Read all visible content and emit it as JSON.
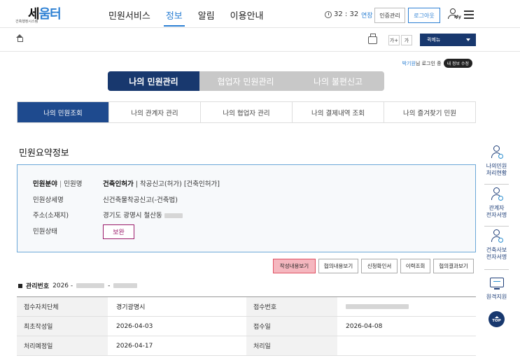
{
  "header": {
    "logo_main_prefix": "세",
    "logo_main_suffix": "움터",
    "logo_sub": "건축행정시스템",
    "nav": [
      "민원서비스",
      "정보",
      "알림",
      "이용안내"
    ],
    "active_nav_index": 1,
    "timer": "32 : 32",
    "extend_label": "연장",
    "cert_label": "인증관리",
    "logout_label": "로그아웃",
    "my_label": "My"
  },
  "subbar": {
    "font_up": "가+",
    "font_down": "가",
    "quick_menu": "퀵메뉴"
  },
  "login": {
    "user": "박기원",
    "suffix": "님 로그인 중",
    "edit": "내 정보 수정"
  },
  "big_tabs": [
    "나의 민원관리",
    "협업자 민원관리",
    "나의 불편신고"
  ],
  "sub_tabs": [
    "나의 민원조회",
    "나의 관계자 관리",
    "나의 협업자 관리",
    "나의 결제내역 조회",
    "나의 즐겨찾기 민원"
  ],
  "summary": {
    "title": "민원요약정보",
    "field_label_bold": "민원분야",
    "field_label_sep": " | ",
    "field_label_rest": "민원명",
    "field_value_bold": "건축인허가",
    "field_value_rest": " | 착공신고(허가) [건축인허가]",
    "detail_label": "민원상세명",
    "detail_value": "신건축물착공신고(-건축법)",
    "address_label": "주소(소재지)",
    "address_value": "경기도 광명시 철산동",
    "status_label": "민원상태",
    "status_value": "보완"
  },
  "actions": [
    "작성내용보기",
    "협의내용보기",
    "신청확인서",
    "이력조회",
    "협의결과보기"
  ],
  "management": {
    "label": "관리번호",
    "prefix": "2026 -"
  },
  "table": {
    "rows": [
      {
        "l1": "접수자치단체",
        "v1": "경기광명시",
        "l2": "접수번호",
        "v2": ""
      },
      {
        "l1": "최초작성일",
        "v1": "2026-04-03",
        "l2": "접수일",
        "v2": "2026-04-08"
      },
      {
        "l1": "처리예정일",
        "v1": "2026-04-17",
        "l2": "처리일",
        "v2": ""
      }
    ]
  },
  "side_nav": [
    {
      "line1": "나의민원",
      "line2": "처리현황"
    },
    {
      "line1": "관계자",
      "line2": "전자서명"
    },
    {
      "line1": "건축사보",
      "line2": "전자서명"
    },
    {
      "line1": "원격지원",
      "line2": ""
    }
  ],
  "top_label": "TOP",
  "colors": {
    "primary_navy": "#18386e",
    "accent_blue": "#2b7fd3",
    "status_magenta": "#9b1b6b",
    "highlight_pink": "#f5b7bf"
  }
}
